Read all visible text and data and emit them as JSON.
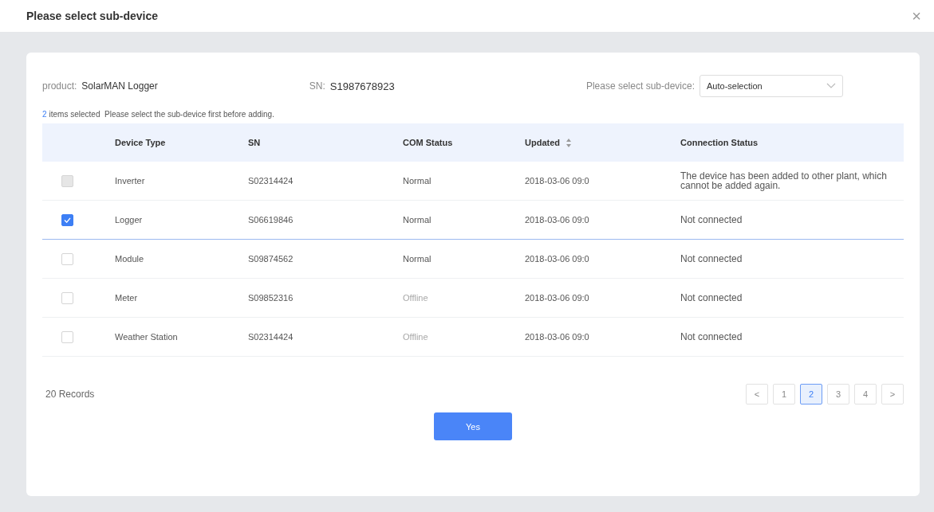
{
  "dialog": {
    "title": "Please select sub-device",
    "close": "×"
  },
  "info": {
    "product_label": "product:",
    "product": "SolarMAN Logger",
    "sn_label": "SN:",
    "sn": "S1987678923",
    "select_label": "Please select sub-device:",
    "select_value": "Auto-selection"
  },
  "selection": {
    "count": "2",
    "text": "items selected  Please select the sub-device first before adding."
  },
  "table": {
    "columns": [
      "Device Type",
      "SN",
      "COM Status",
      "Updated",
      "Connection Status"
    ],
    "rows": [
      {
        "type": "Inverter",
        "sn": "S02314424",
        "com": "Normal",
        "online": true,
        "updated": "2018-03-06  09:0",
        "connection": "The device has been added to other plant, which cannot be added again.",
        "checked": false,
        "disabled": true
      },
      {
        "type": "Logger",
        "sn": "S06619846",
        "com": "Normal",
        "online": true,
        "updated": "2018-03-06  09:0",
        "connection": "Not connected",
        "checked": true,
        "disabled": false
      },
      {
        "type": "Module",
        "sn": "S09874562",
        "com": "Normal",
        "online": true,
        "updated": "2018-03-06  09:0",
        "connection": "Not connected",
        "checked": false,
        "disabled": false
      },
      {
        "type": "Meter",
        "sn": "S09852316",
        "com": "Offline",
        "online": false,
        "updated": "2018-03-06  09:0",
        "connection": "Not connected",
        "checked": false,
        "disabled": false
      },
      {
        "type": "Weather Station",
        "sn": "S02314424",
        "com": "Offline",
        "online": false,
        "updated": "2018-03-06  09:0",
        "connection": "Not connected",
        "checked": false,
        "disabled": false
      }
    ]
  },
  "records": "20 Records",
  "pagination": {
    "prev": "<",
    "next": ">",
    "pages": [
      {
        "label": "1",
        "selected": false
      },
      {
        "label": "2",
        "selected": true
      },
      {
        "label": "3",
        "selected": false
      },
      {
        "label": "4",
        "selected": false
      }
    ]
  },
  "confirm": "Yes"
}
